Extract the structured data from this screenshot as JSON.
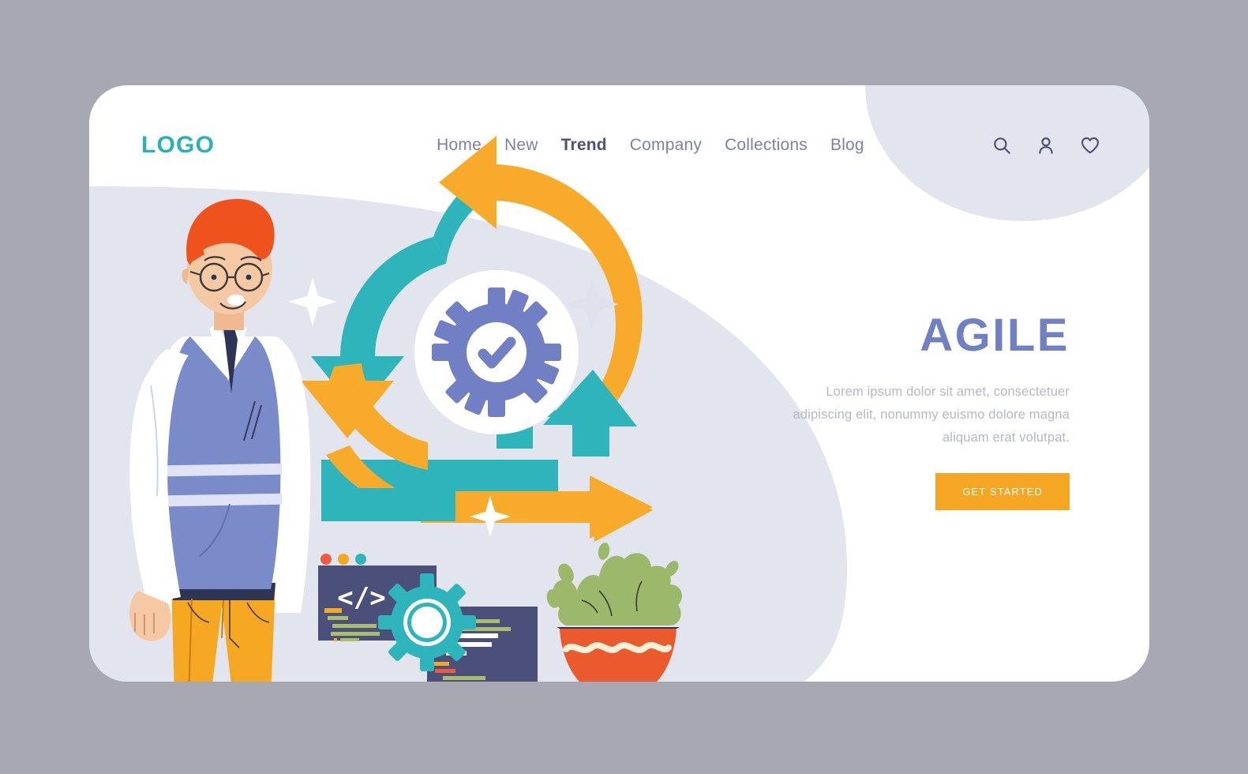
{
  "page": {
    "background_color": "#a8a8b2",
    "card_color": "#ffffff",
    "accent_teal": "#29b2b6",
    "accent_orange": "#f5a623",
    "accent_periwinkle": "#7180c4",
    "lavender": "#e2e4ee"
  },
  "header": {
    "logo": "LOGO",
    "nav": [
      {
        "label": "Home",
        "active": false
      },
      {
        "label": "New",
        "active": false
      },
      {
        "label": "Trend",
        "active": true
      },
      {
        "label": "Company",
        "active": false
      },
      {
        "label": "Collections",
        "active": false
      },
      {
        "label": "Blog",
        "active": false
      }
    ],
    "actions": [
      {
        "icon": "search-icon",
        "label": "Search"
      },
      {
        "icon": "user-icon",
        "label": "Account"
      },
      {
        "icon": "heart-icon",
        "label": "Favorites"
      }
    ]
  },
  "hero": {
    "headline": "AGILE",
    "paragraph": "Lorem ipsum dolor sit amet, consectetuer adipiscing elit, nonummy euismo dolore magna aliquam erat volutpat.",
    "cta_label": "GET STARTED"
  },
  "illustration": {
    "alt": "Man with glasses beside agile cycle diagram, code windows and potted plant",
    "elements": [
      "agile-cycle-arrows",
      "gear-check-icon",
      "developer-character",
      "code-window-back",
      "code-window-front",
      "teal-gear",
      "potted-plant",
      "sparkle-stars",
      "ground-line"
    ],
    "colors": {
      "cycle_teal": "#2eb5bb",
      "cycle_orange": "#f8ab2a",
      "gear_periwinkle": "#7180c4",
      "hair_orange": "#f0521e",
      "vest_blue": "#7a8bc9",
      "trousers_yellow": "#f7a823",
      "code_window_navy": "#4a5079",
      "pot_red": "#ea5a2d",
      "plant_green": "#9cb86a"
    }
  }
}
